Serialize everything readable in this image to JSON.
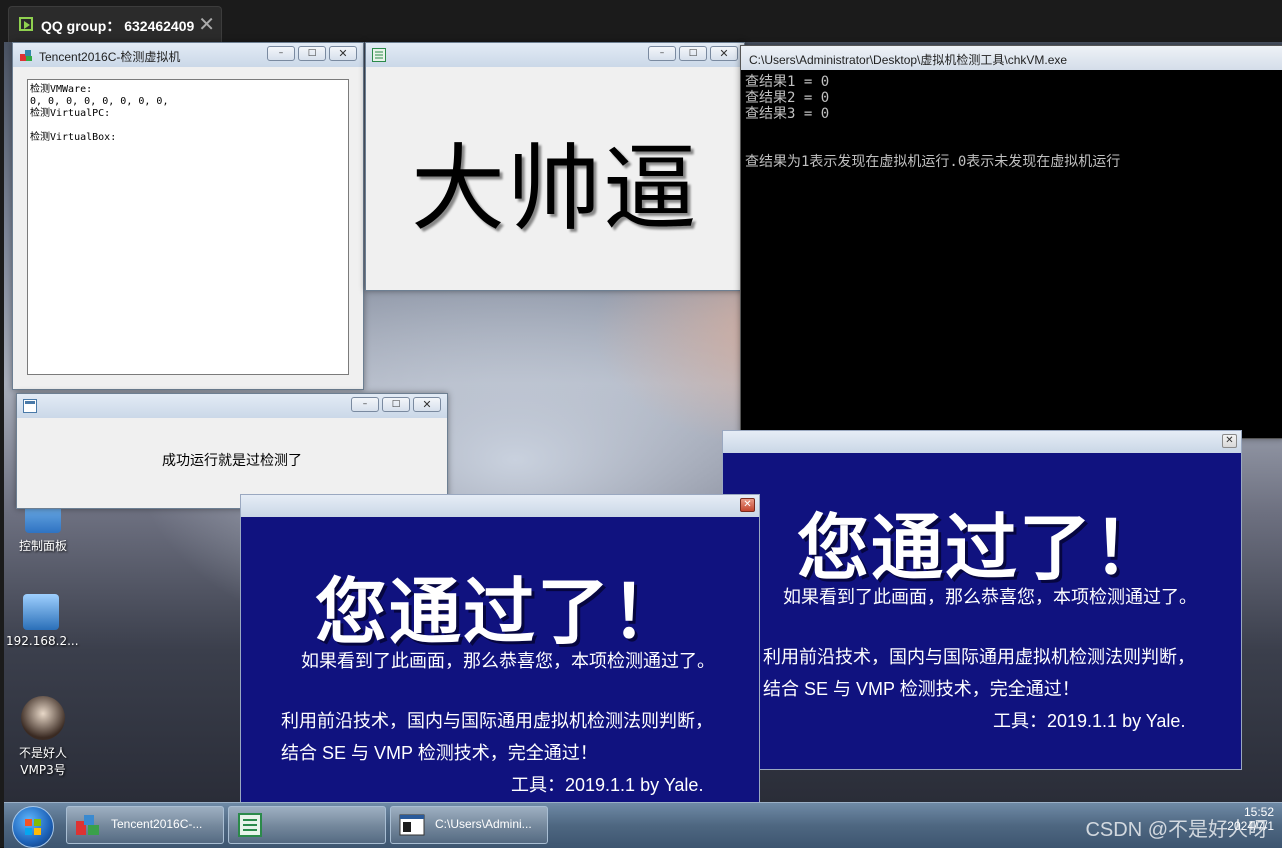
{
  "vm_tab": {
    "title": "QQ group： 632462409",
    "close": "✕"
  },
  "desktop_icons": [
    {
      "label": "控制面板"
    },
    {
      "label": "192.168.2..."
    },
    {
      "label": "不是好人 VMP3号"
    }
  ],
  "detector": {
    "title": "Tencent2016C-检测虚拟机",
    "body": "检测VMWare:\n0, 0, 0, 0, 0, 0, 0, 0,\n检测VirtualPC:\n\n检测VirtualBox:"
  },
  "big_window": {
    "text": "大帅逼"
  },
  "console": {
    "title": "C:\\Users\\Administrator\\Desktop\\虚拟机检测工具\\chkVM.exe",
    "lines": "查结果1 = 0\n查结果2 = 0\n查结果3 = 0\n\n\n查结果为1表示发现在虚拟机运行.0表示未发现在虚拟机运行"
  },
  "success": {
    "message": "成功运行就是过检测了"
  },
  "pass": {
    "headline": "您通过了！",
    "line1": "如果看到了此画面，那么恭喜您，本项检测通过了。",
    "line2": "利用前沿技术，国内与国际通用虚拟机检测法则判断，",
    "line3": "结合 SE 与 VMP 检测技术，完全通过！",
    "line4": "工具：2019.1.1  by Yale."
  },
  "window_buttons": {
    "minimize": "–",
    "maximize": "□",
    "close": "✕"
  },
  "taskbar": {
    "items": [
      {
        "label": "Tencent2016C-..."
      },
      {
        "label": ""
      },
      {
        "label": "C:\\Users\\Admini..."
      }
    ],
    "time": "15:52",
    "date": "2024/7/1",
    "watermark": "CSDN @不是好人呀"
  },
  "colors": {
    "pass_bg": "#10127f",
    "console_bg": "#000000",
    "taskbar": "#4e6781"
  }
}
